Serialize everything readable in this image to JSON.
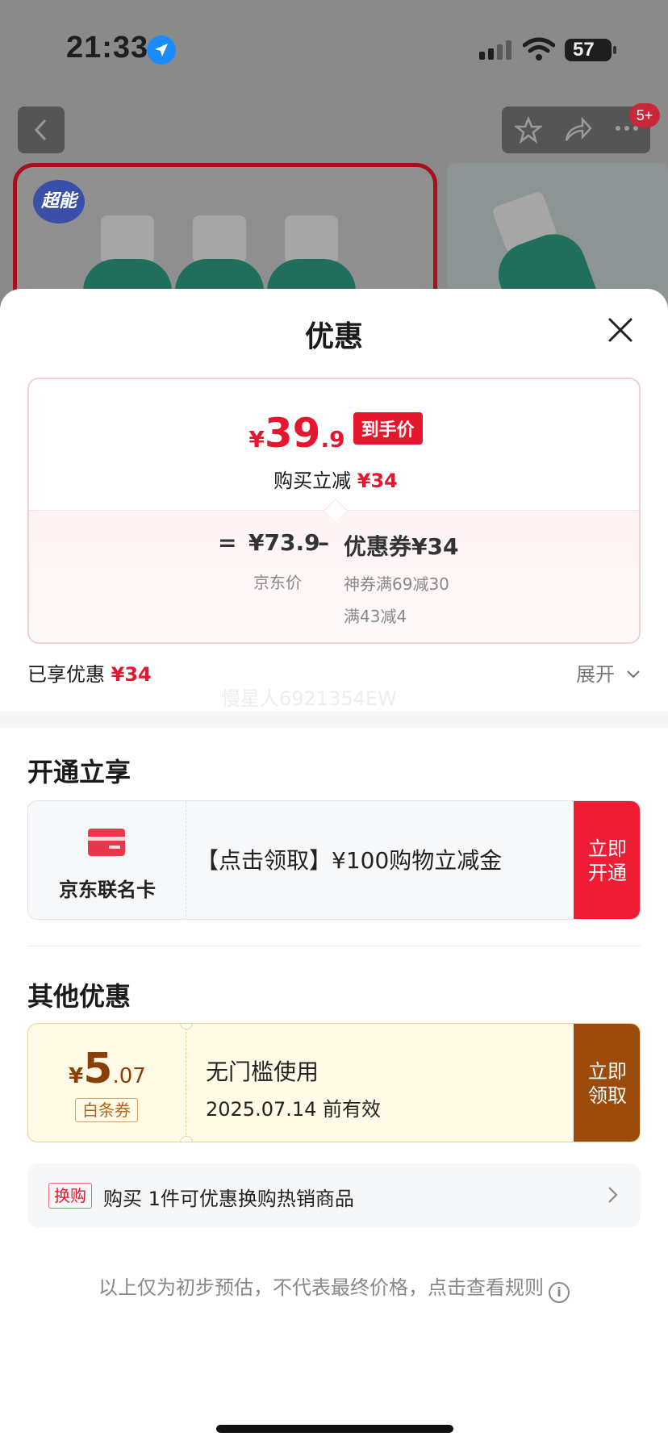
{
  "status_bar": {
    "time": "21:33",
    "battery": "57"
  },
  "nav": {
    "badge": "5+"
  },
  "product": {
    "brand_logo": "超能"
  },
  "sheet": {
    "title": "优惠",
    "price": {
      "currency": "¥",
      "integer": "39",
      "decimal": ".9",
      "tag": "到手价",
      "instant_label": "购买立减",
      "instant_amount": "¥34"
    },
    "formula": {
      "equals": "=",
      "jd_price": "¥73.9",
      "jd_label": "京东价",
      "minus": "–",
      "coupon_total": "优惠券¥34",
      "coupon_detail_1": "神券满69减30",
      "coupon_detail_2": "满43减4"
    },
    "enjoyed_label": "已享优惠",
    "enjoyed_amount": "¥34",
    "expand_label": "展开",
    "watermark": "慢星人6921354EW",
    "open_section": {
      "title": "开通立享",
      "card_name": "京东联名卡",
      "offer": "【点击领取】¥100购物立减金",
      "button": "立即开通"
    },
    "other_section": {
      "title": "其他优惠",
      "coupon": {
        "currency": "¥",
        "integer": "5",
        "decimal": ".07",
        "type": "白条券",
        "condition": "无门槛使用",
        "expiry": "2025.07.14 前有效",
        "button": "立即领取"
      }
    },
    "exchange": {
      "tag": "换购",
      "text": "购买 1件可优惠换购热销商品"
    },
    "footnote": "以上仅为初步预估，不代表最终价格，点击查看规则"
  },
  "colors": {
    "accent_red": "#e5172e",
    "coupon_brown": "#9c4b0a",
    "coupon_bg": "#fffbe6"
  }
}
